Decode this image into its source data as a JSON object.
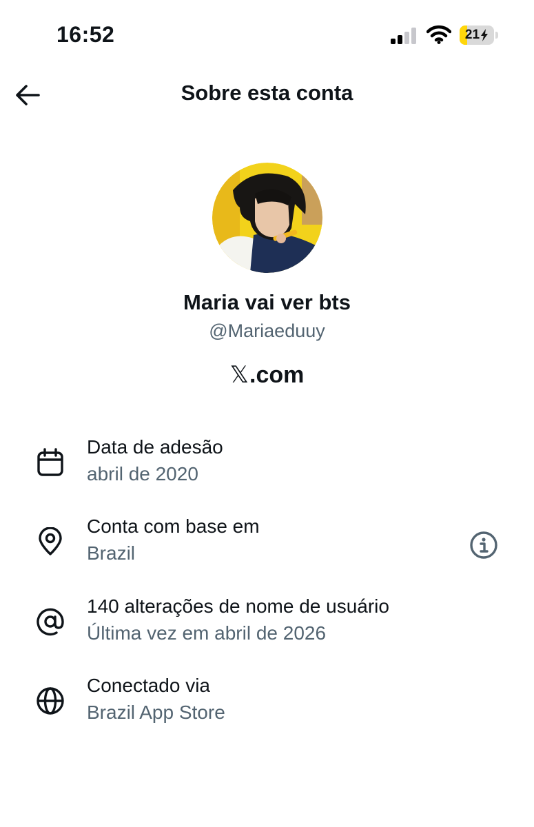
{
  "status_bar": {
    "time": "16:52",
    "battery_level": "21",
    "battery_percent": 21,
    "battery_color": "#ffd60a",
    "signal_icon": "signal-icon",
    "wifi_icon": "wifi-icon"
  },
  "header": {
    "title": "Sobre esta conta",
    "back_icon": "back-arrow-icon"
  },
  "profile": {
    "display_name": "Maria vai ver bts",
    "handle": "@Mariaeduuy",
    "domain_glyph": "𝕏",
    "domain_suffix": ".com"
  },
  "info": [
    {
      "icon": "calendar-icon",
      "title": "Data de adesão",
      "value": "abril de 2020"
    },
    {
      "icon": "location-pin-icon",
      "title": "Conta com base em",
      "value": "Brazil",
      "action_icon": "info-icon"
    },
    {
      "icon": "at-sign-icon",
      "title": "140 alterações de nome de usuário",
      "value": "Última vez em abril de 2026"
    },
    {
      "icon": "globe-icon",
      "title": "Conectado via",
      "value": "Brazil App Store"
    }
  ],
  "colors": {
    "text_primary": "#0f1419",
    "text_secondary": "#536471",
    "avatar_accent": "#f2d21b"
  }
}
